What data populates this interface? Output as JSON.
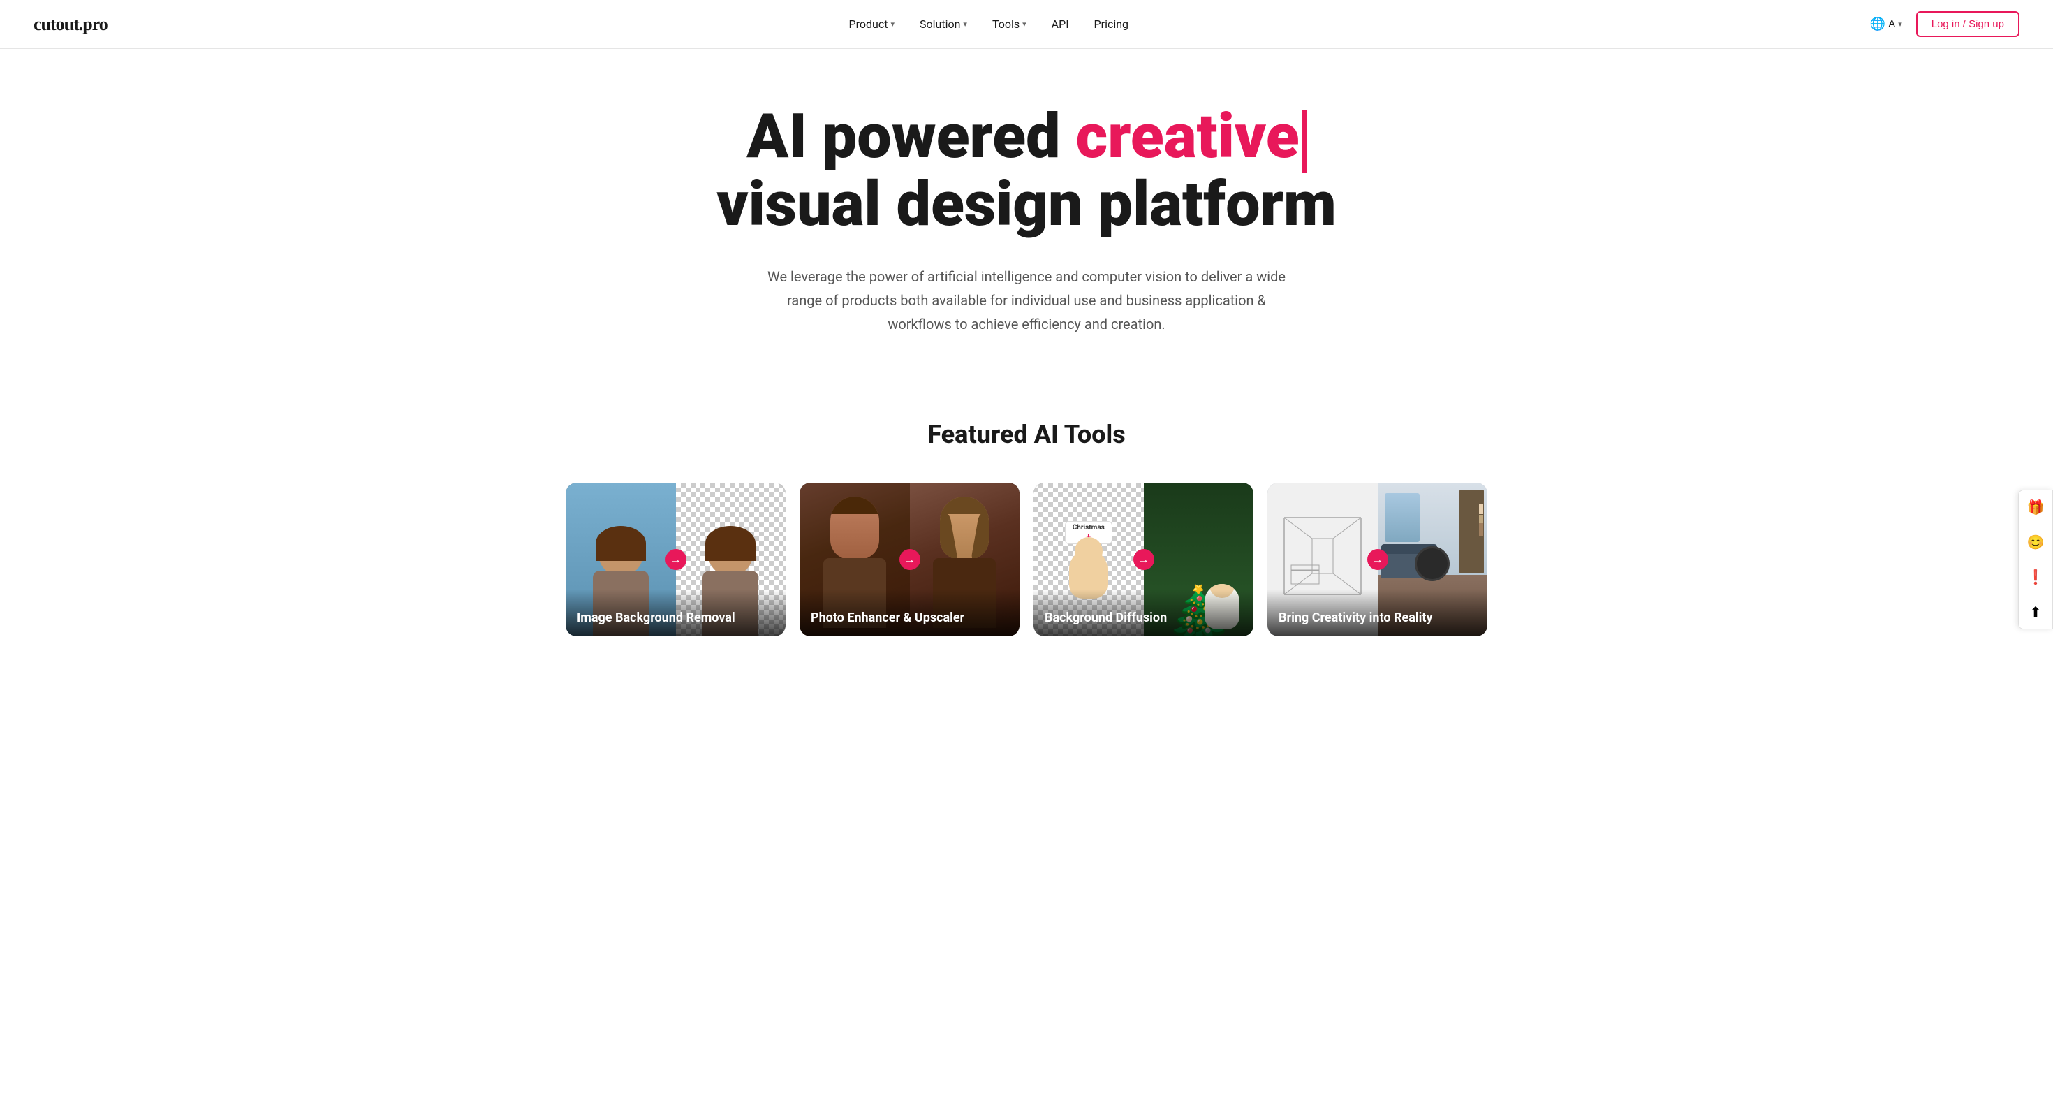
{
  "logo": {
    "text": "cutout.pro"
  },
  "nav": {
    "links": [
      {
        "label": "Product",
        "hasDropdown": true
      },
      {
        "label": "Solution",
        "hasDropdown": true
      },
      {
        "label": "Tools",
        "hasDropdown": true
      },
      {
        "label": "API",
        "hasDropdown": false
      },
      {
        "label": "Pricing",
        "hasDropdown": false
      }
    ],
    "lang_icon": "🌐",
    "lang_label": "A",
    "login_label": "Log in / Sign up"
  },
  "hero": {
    "title_part1": "AI powered ",
    "title_highlight": "creative",
    "title_part2": "visual design platform",
    "description": "We leverage the power of artificial intelligence and computer vision to deliver a wide range of products both available for individual use and business application & workflows to achieve efficiency and creation."
  },
  "featured": {
    "section_title": "Featured AI Tools",
    "tools": [
      {
        "label": "Image Background Removal",
        "id": "bg-removal"
      },
      {
        "label": "Photo Enhancer & Upscaler",
        "id": "photo-enhancer"
      },
      {
        "label": "Background Diffusion",
        "id": "bg-diffusion"
      },
      {
        "label": "Bring Creativity into Reality",
        "id": "creativity"
      }
    ]
  },
  "sidebar": {
    "buttons": [
      {
        "icon": "🎁",
        "name": "gift-icon"
      },
      {
        "icon": "😊",
        "name": "avatar-icon"
      },
      {
        "icon": "❗",
        "name": "alert-icon"
      },
      {
        "icon": "⬆",
        "name": "upload-icon"
      }
    ]
  },
  "colors": {
    "accent": "#e8185a",
    "dark": "#1a1a1a",
    "gray": "#555"
  }
}
